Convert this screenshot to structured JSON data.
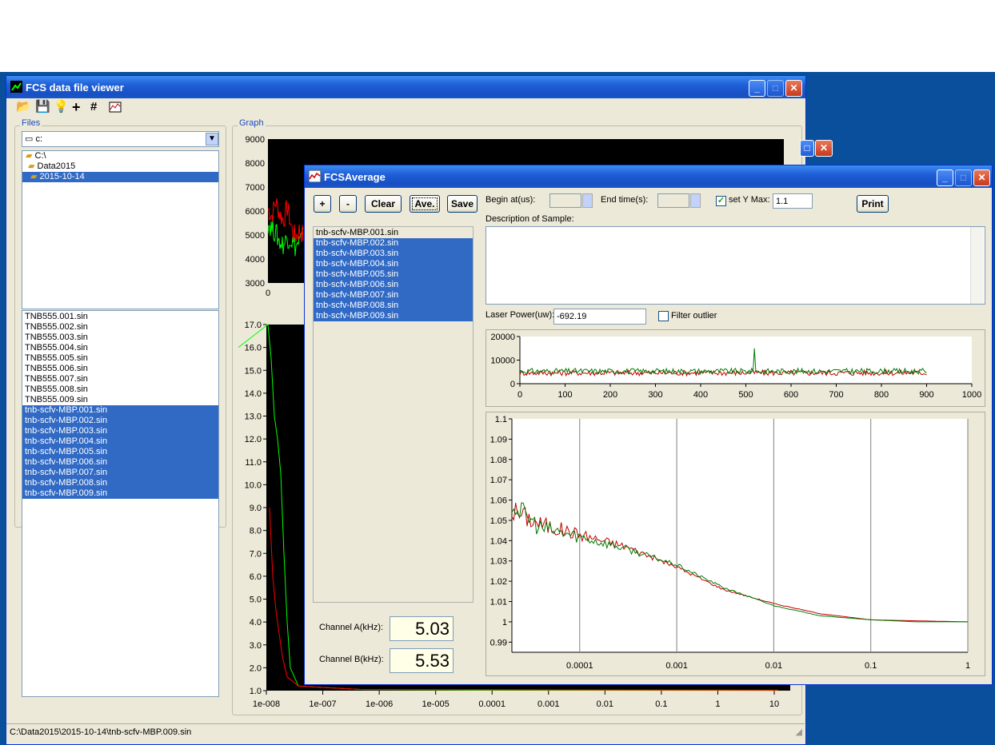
{
  "main_window": {
    "title": "FCS data file viewer",
    "files_label": "Files",
    "graph_label": "Graph",
    "drive_value": "c:",
    "folders": [
      "C:\\",
      "Data2015",
      "2015-10-14"
    ],
    "selected_folder": "2015-10-14",
    "files": [
      {
        "name": "TNB555.001.sin",
        "selected": false
      },
      {
        "name": "TNB555.002.sin",
        "selected": false
      },
      {
        "name": "TNB555.003.sin",
        "selected": false
      },
      {
        "name": "TNB555.004.sin",
        "selected": false
      },
      {
        "name": "TNB555.005.sin",
        "selected": false
      },
      {
        "name": "TNB555.006.sin",
        "selected": false
      },
      {
        "name": "TNB555.007.sin",
        "selected": false
      },
      {
        "name": "TNB555.008.sin",
        "selected": false
      },
      {
        "name": "TNB555.009.sin",
        "selected": false
      },
      {
        "name": "tnb-scfv-MBP.001.sin",
        "selected": true
      },
      {
        "name": "tnb-scfv-MBP.002.sin",
        "selected": true
      },
      {
        "name": "tnb-scfv-MBP.003.sin",
        "selected": true
      },
      {
        "name": "tnb-scfv-MBP.004.sin",
        "selected": true
      },
      {
        "name": "tnb-scfv-MBP.005.sin",
        "selected": true
      },
      {
        "name": "tnb-scfv-MBP.006.sin",
        "selected": true
      },
      {
        "name": "tnb-scfv-MBP.007.sin",
        "selected": true
      },
      {
        "name": "tnb-scfv-MBP.008.sin",
        "selected": true
      },
      {
        "name": "tnb-scfv-MBP.009.sin",
        "selected": true
      }
    ],
    "status_text": "C:\\Data2015\\2015-10-14\\tnb-scfv-MBP.009.sin",
    "toolbar_icons": [
      "open-folder-icon",
      "save-disk-icon",
      "bulb-icon",
      "crosshair-icon",
      "grid-icon",
      "chart-settings-icon"
    ],
    "colors": {
      "plot_bg": "#000000",
      "trace_green": "#00ff00",
      "trace_red": "#ff0000"
    }
  },
  "avg_window": {
    "title": "FCSAverage",
    "buttons": {
      "add": "+",
      "remove": "-",
      "clear": "Clear",
      "average": "Ave.",
      "save": "Save",
      "print": "Print"
    },
    "begin_label": "Begin at(us):",
    "end_label": "End time(s):",
    "begin_value": "",
    "end_value": "",
    "set_y_max_label": "set Y Max:",
    "set_y_max_checked": true,
    "y_max_value": "1.1",
    "description_label": "Description of Sample:",
    "description_value": "",
    "laser_power_label": "Laser Power(uw):",
    "laser_power_value": "-692.19",
    "filter_outlier_label": "Filter outlier",
    "filter_outlier_checked": false,
    "file_list": [
      {
        "name": "tnb-scfv-MBP.001.sin",
        "selected": false
      },
      {
        "name": "tnb-scfv-MBP.002.sin",
        "selected": true
      },
      {
        "name": "tnb-scfv-MBP.003.sin",
        "selected": true
      },
      {
        "name": "tnb-scfv-MBP.004.sin",
        "selected": true
      },
      {
        "name": "tnb-scfv-MBP.005.sin",
        "selected": true
      },
      {
        "name": "tnb-scfv-MBP.006.sin",
        "selected": true
      },
      {
        "name": "tnb-scfv-MBP.007.sin",
        "selected": true
      },
      {
        "name": "tnb-scfv-MBP.008.sin",
        "selected": true
      },
      {
        "name": "tnb-scfv-MBP.009.sin",
        "selected": true
      }
    ],
    "channel_a_label": "Channel A(kHz):",
    "channel_a_value": "5.03",
    "channel_b_label": "Channel B(kHz):",
    "channel_b_value": "5.53",
    "colors": {
      "trace_green": "#007a00",
      "trace_red": "#c00000"
    }
  },
  "chart_data": [
    {
      "type": "line",
      "name": "main-trace",
      "y_ticks": [
        "3000",
        "4000",
        "5000",
        "6000",
        "7000",
        "8000",
        "9000"
      ],
      "x_ticks": [
        "0"
      ],
      "ylim": [
        3000,
        9000
      ],
      "series": [
        {
          "values": [
            6100,
            5800,
            6400,
            5900,
            5600,
            6200,
            5300,
            4900,
            5200,
            5000
          ]
        },
        {
          "values": [
            5500,
            5300,
            5100,
            4700,
            4600,
            4900,
            4800,
            4500,
            4700,
            4900
          ]
        }
      ]
    },
    {
      "type": "line",
      "name": "main-correlation",
      "x_ticks": [
        "1e-008",
        "1e-007",
        "1e-006",
        "1e-005",
        "0.0001",
        "0.001",
        "0.01",
        "0.1",
        "1",
        "10"
      ],
      "y_ticks": [
        "1.0",
        "2.0",
        "3.0",
        "4.0",
        "5.0",
        "6.0",
        "7.0",
        "8.0",
        "9.0",
        "10.0",
        "11.0",
        "12.0",
        "13.0",
        "14.0",
        "15.0",
        "16.0",
        "17.0"
      ],
      "ylim": [
        1,
        17
      ]
    },
    {
      "type": "line",
      "name": "count-trace",
      "x_ticks": [
        "0",
        "100",
        "200",
        "300",
        "400",
        "500",
        "600",
        "700",
        "800",
        "900",
        "1000"
      ],
      "y_ticks": [
        "0",
        "10000",
        "20000"
      ],
      "xlim": [
        0,
        1000
      ],
      "ylim": [
        0,
        20000
      ],
      "series": [
        {
          "x": [
            0,
            900
          ],
          "baseline": 5300,
          "spike_x": 520,
          "spike_y": 15000
        },
        {
          "x": [
            0,
            900
          ],
          "baseline": 4600
        }
      ]
    },
    {
      "type": "line",
      "name": "average-correlation",
      "x_ticks": [
        "0.0001",
        "0.001",
        "0.01",
        "0.1",
        "1"
      ],
      "y_ticks": [
        "0.99",
        "1",
        "1.01",
        "1.02",
        "1.03",
        "1.04",
        "1.05",
        "1.06",
        "1.07",
        "1.08",
        "1.09",
        "1.1"
      ],
      "xscale": "log",
      "xlim": [
        2e-05,
        1
      ],
      "ylim": [
        0.985,
        1.1
      ],
      "series": [
        {
          "x": [
            2e-05,
            4e-05,
            0.0001,
            0.0003,
            0.001,
            0.003,
            0.01,
            0.03,
            0.1,
            0.3,
            1
          ],
          "y": [
            1.055,
            1.048,
            1.043,
            1.037,
            1.027,
            1.016,
            1.009,
            1.004,
            1.001,
            1.0005,
            1.0
          ]
        },
        {
          "x": [
            2e-05,
            4e-05,
            0.0001,
            0.0003,
            0.001,
            0.003,
            0.01,
            0.03,
            0.1,
            0.3,
            1
          ],
          "y": [
            1.058,
            1.046,
            1.042,
            1.036,
            1.028,
            1.017,
            1.008,
            1.003,
            1.001,
            1.0,
            1.0
          ]
        }
      ]
    }
  ]
}
